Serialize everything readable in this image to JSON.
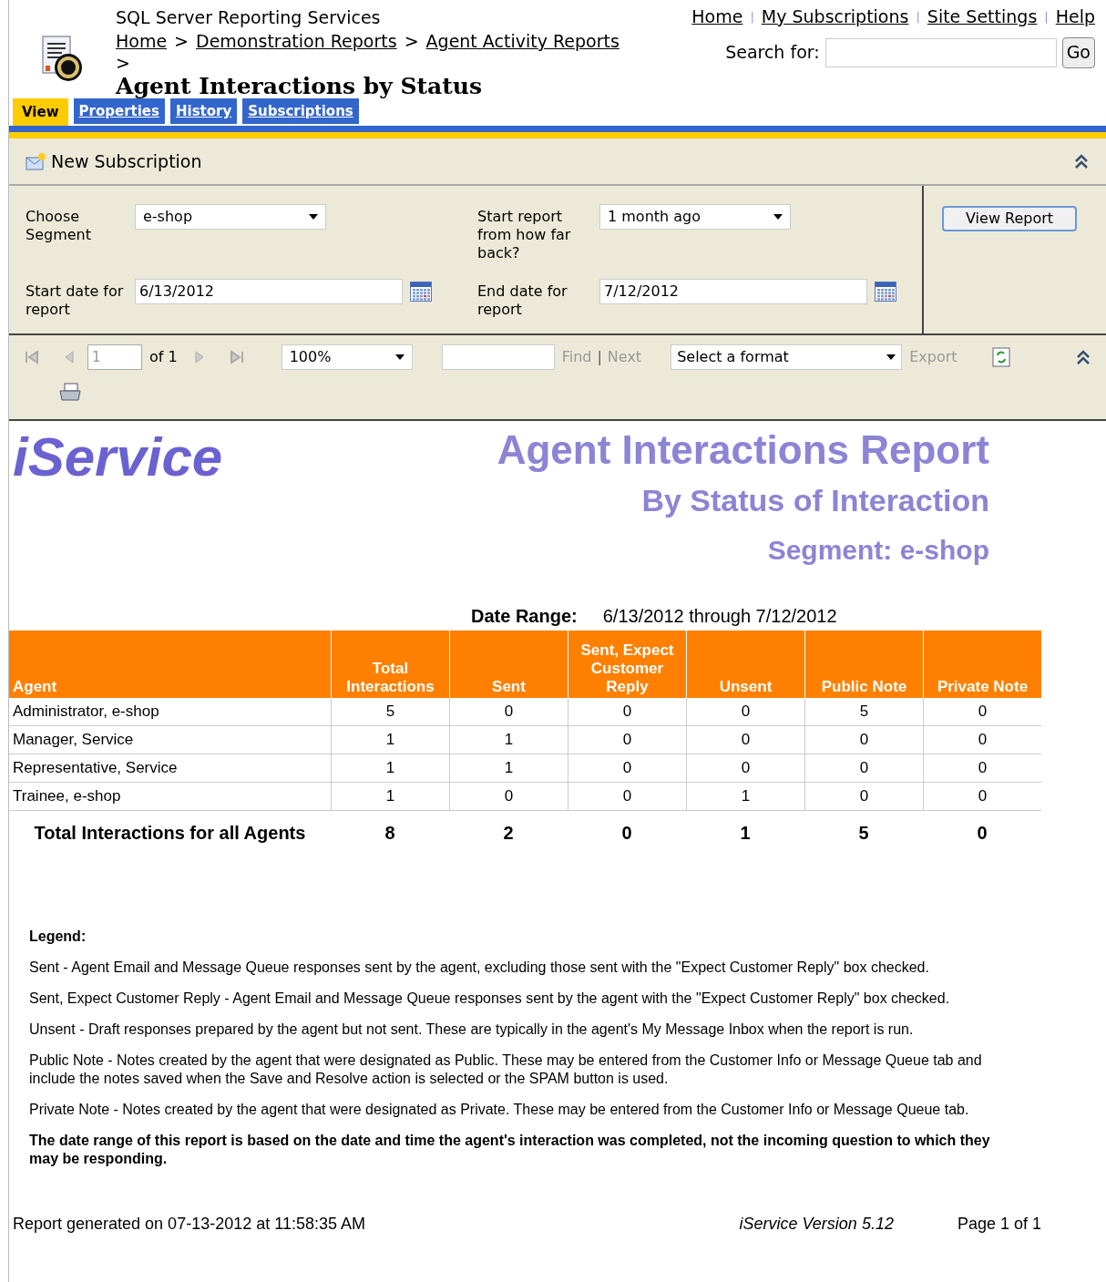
{
  "header": {
    "app_title": "SQL Server Reporting Services",
    "breadcrumbs": [
      "Home",
      "Demonstration Reports",
      "Agent Activity Reports"
    ],
    "separator": ">",
    "page_title": "Agent Interactions by Status"
  },
  "top_links": [
    "Home",
    "My Subscriptions",
    "Site Settings",
    "Help"
  ],
  "top_link_separator": "|",
  "search": {
    "label": "Search for:",
    "button": "Go"
  },
  "tabs": [
    {
      "label": "View",
      "selected": true
    },
    {
      "label": "Properties",
      "selected": false
    },
    {
      "label": "History",
      "selected": false
    },
    {
      "label": "Subscriptions",
      "selected": false
    }
  ],
  "subscription_bar": {
    "label": "New Subscription"
  },
  "parameters": [
    {
      "label": "Choose Segment",
      "kind": "select",
      "value": "e-shop"
    },
    {
      "label": "Start report from how far back?",
      "kind": "select",
      "value": "1 month ago"
    },
    {
      "label": "Start date for report",
      "kind": "date",
      "value": "6/13/2012"
    },
    {
      "label": "End date for report",
      "kind": "date",
      "value": "7/12/2012"
    }
  ],
  "view_report_button": "View Report",
  "toolbar": {
    "page": "1",
    "of": "of 1",
    "zoom": "100%",
    "find": "Find",
    "separator": "|",
    "next": "Next",
    "format": "Select a format",
    "export": "Export"
  },
  "report": {
    "logo": "iService",
    "title": "Agent Interactions Report",
    "subtitle": "By Status of Interaction",
    "segment": "Segment: e-shop",
    "date_range_label": "Date Range:",
    "date_range": "6/13/2012 through 7/12/2012",
    "table": {
      "columns": [
        "Agent",
        "Total Interactions",
        "Sent",
        "Sent, Expect Customer Reply",
        "Unsent",
        "Public Note",
        "Private Note"
      ],
      "rows": [
        [
          "Administrator, e-shop",
          "5",
          "0",
          "0",
          "0",
          "5",
          "0"
        ],
        [
          "Manager, Service",
          "1",
          "1",
          "0",
          "0",
          "0",
          "0"
        ],
        [
          "Representative, Service",
          "1",
          "1",
          "0",
          "0",
          "0",
          "0"
        ],
        [
          "Trainee, e-shop",
          "1",
          "0",
          "0",
          "1",
          "0",
          "0"
        ]
      ],
      "totals": [
        "Total Interactions for all Agents",
        "8",
        "2",
        "0",
        "1",
        "5",
        "0"
      ]
    },
    "legend_title": "Legend:",
    "legend": [
      "Sent - Agent Email and Message Queue responses sent by the agent, excluding those sent with the \"Expect Customer Reply\" box checked.",
      "Sent, Expect Customer Reply - Agent Email and Message Queue responses sent by the agent with the \"Expect Customer Reply\" box checked.",
      "Unsent - Draft responses prepared by the agent but not sent. These are typically in the agent's My Message Inbox when the report is run.",
      "Public Note - Notes created by the agent that were designated as Public. These may be entered from the Customer Info or Message Queue tab and include the notes saved when the Save and Resolve action is selected or the SPAM button is used.",
      "Private Note - Notes created by the agent that were designated as Private. These may be entered from the Customer Info or Message Queue tab."
    ],
    "note": "The date range of this report is based on the date and time the agent's interaction was completed, not the incoming question to which they may be responding.",
    "footer": {
      "generated": "Report generated on 07-13-2012 at 11:58:35 AM",
      "version": "iService Version 5.12",
      "page": "Page 1 of 1"
    }
  }
}
